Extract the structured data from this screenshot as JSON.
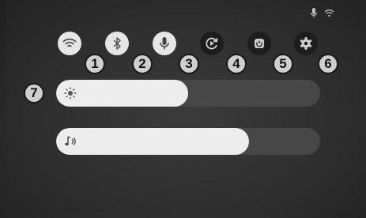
{
  "status_bar": {
    "icons": [
      "microphone-icon",
      "wifi-icon"
    ]
  },
  "quick_settings": {
    "toggles": [
      {
        "id": "wifi",
        "icon": "wifi-icon",
        "state": "on",
        "badge": "1"
      },
      {
        "id": "bluetooth",
        "icon": "bluetooth-icon",
        "state": "on",
        "badge": "2"
      },
      {
        "id": "microphone",
        "icon": "microphone-icon",
        "state": "on",
        "badge": "3"
      },
      {
        "id": "auto-rotate",
        "icon": "rotate-icon",
        "state": "off",
        "badge": "4"
      },
      {
        "id": "power",
        "icon": "power-icon",
        "state": "off",
        "badge": "5"
      },
      {
        "id": "settings",
        "icon": "gear-icon",
        "state": "off",
        "badge": "6"
      }
    ],
    "brightness": {
      "icon": "brightness-icon",
      "level": 0.5,
      "badge": "7"
    },
    "volume": {
      "icon": "volume-icon",
      "level": 0.73
    }
  },
  "colors": {
    "toggle_on": "#e6e6e6",
    "toggle_off": "#1d1d1d",
    "slider_track": "#474747",
    "slider_fill": "#ededed"
  }
}
